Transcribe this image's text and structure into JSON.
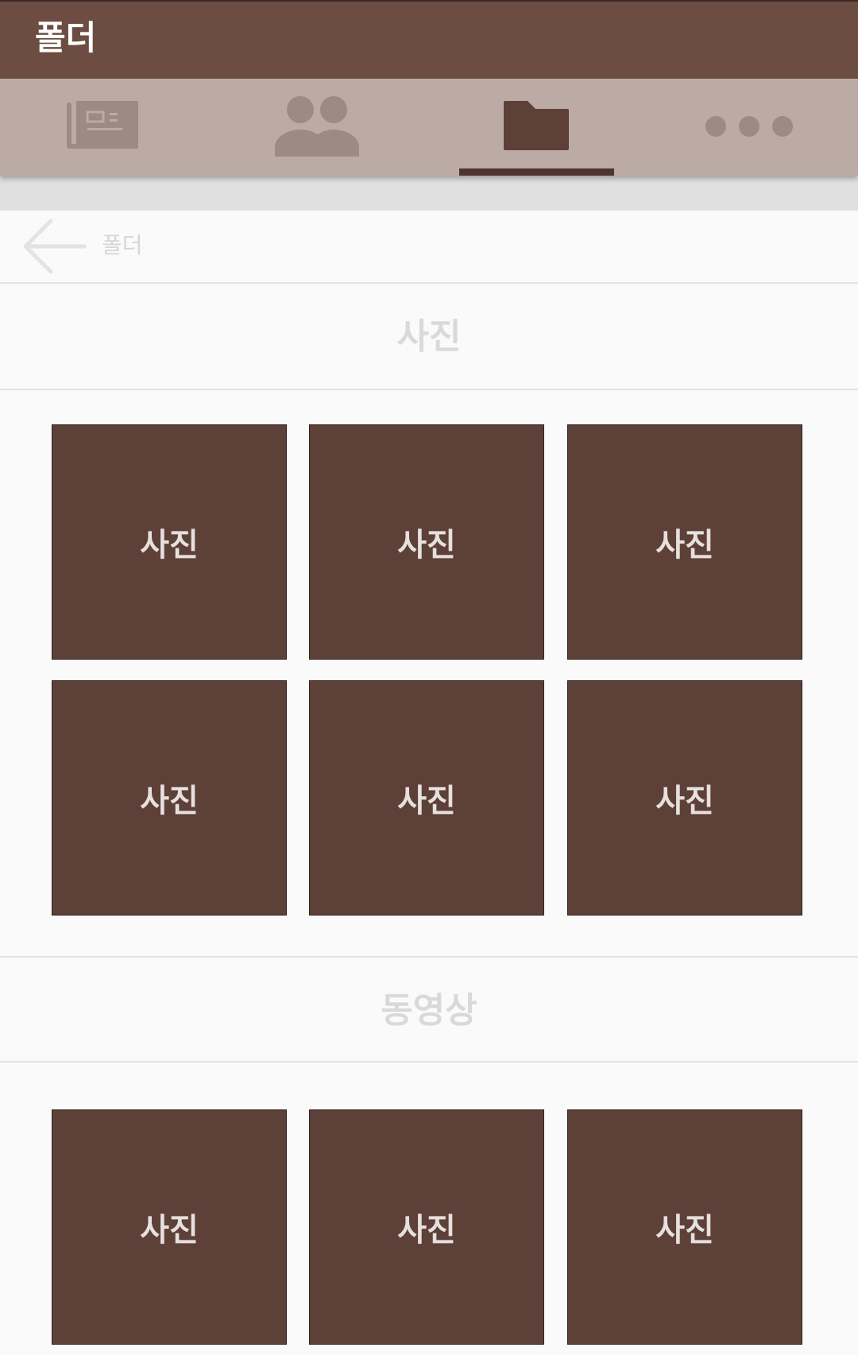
{
  "app_bar": {
    "title": "폴더"
  },
  "tabs": [
    {
      "name": "news",
      "icon": "newspaper-icon",
      "selected": false
    },
    {
      "name": "people",
      "icon": "people-icon",
      "selected": false
    },
    {
      "name": "folder",
      "icon": "folder-icon",
      "selected": true
    },
    {
      "name": "more",
      "icon": "more-horizontal-icon",
      "selected": false
    }
  ],
  "colors": {
    "primary": "#6d4c41",
    "tab_bar": "#bcaaa4",
    "tab_icon": "#9e8a84",
    "tab_icon_selected": "#5d4037",
    "indicator": "#4e342e",
    "tile": "#5d4037",
    "background": "#fafafa"
  },
  "nav": {
    "back_icon": "arrow-left-icon",
    "label": "폴더"
  },
  "sections": {
    "photos": {
      "title": "사진",
      "items": [
        "사진",
        "사진",
        "사진",
        "사진",
        "사진",
        "사진"
      ]
    },
    "videos": {
      "title": "동영상",
      "items": [
        "사진",
        "사진",
        "사진"
      ]
    }
  }
}
